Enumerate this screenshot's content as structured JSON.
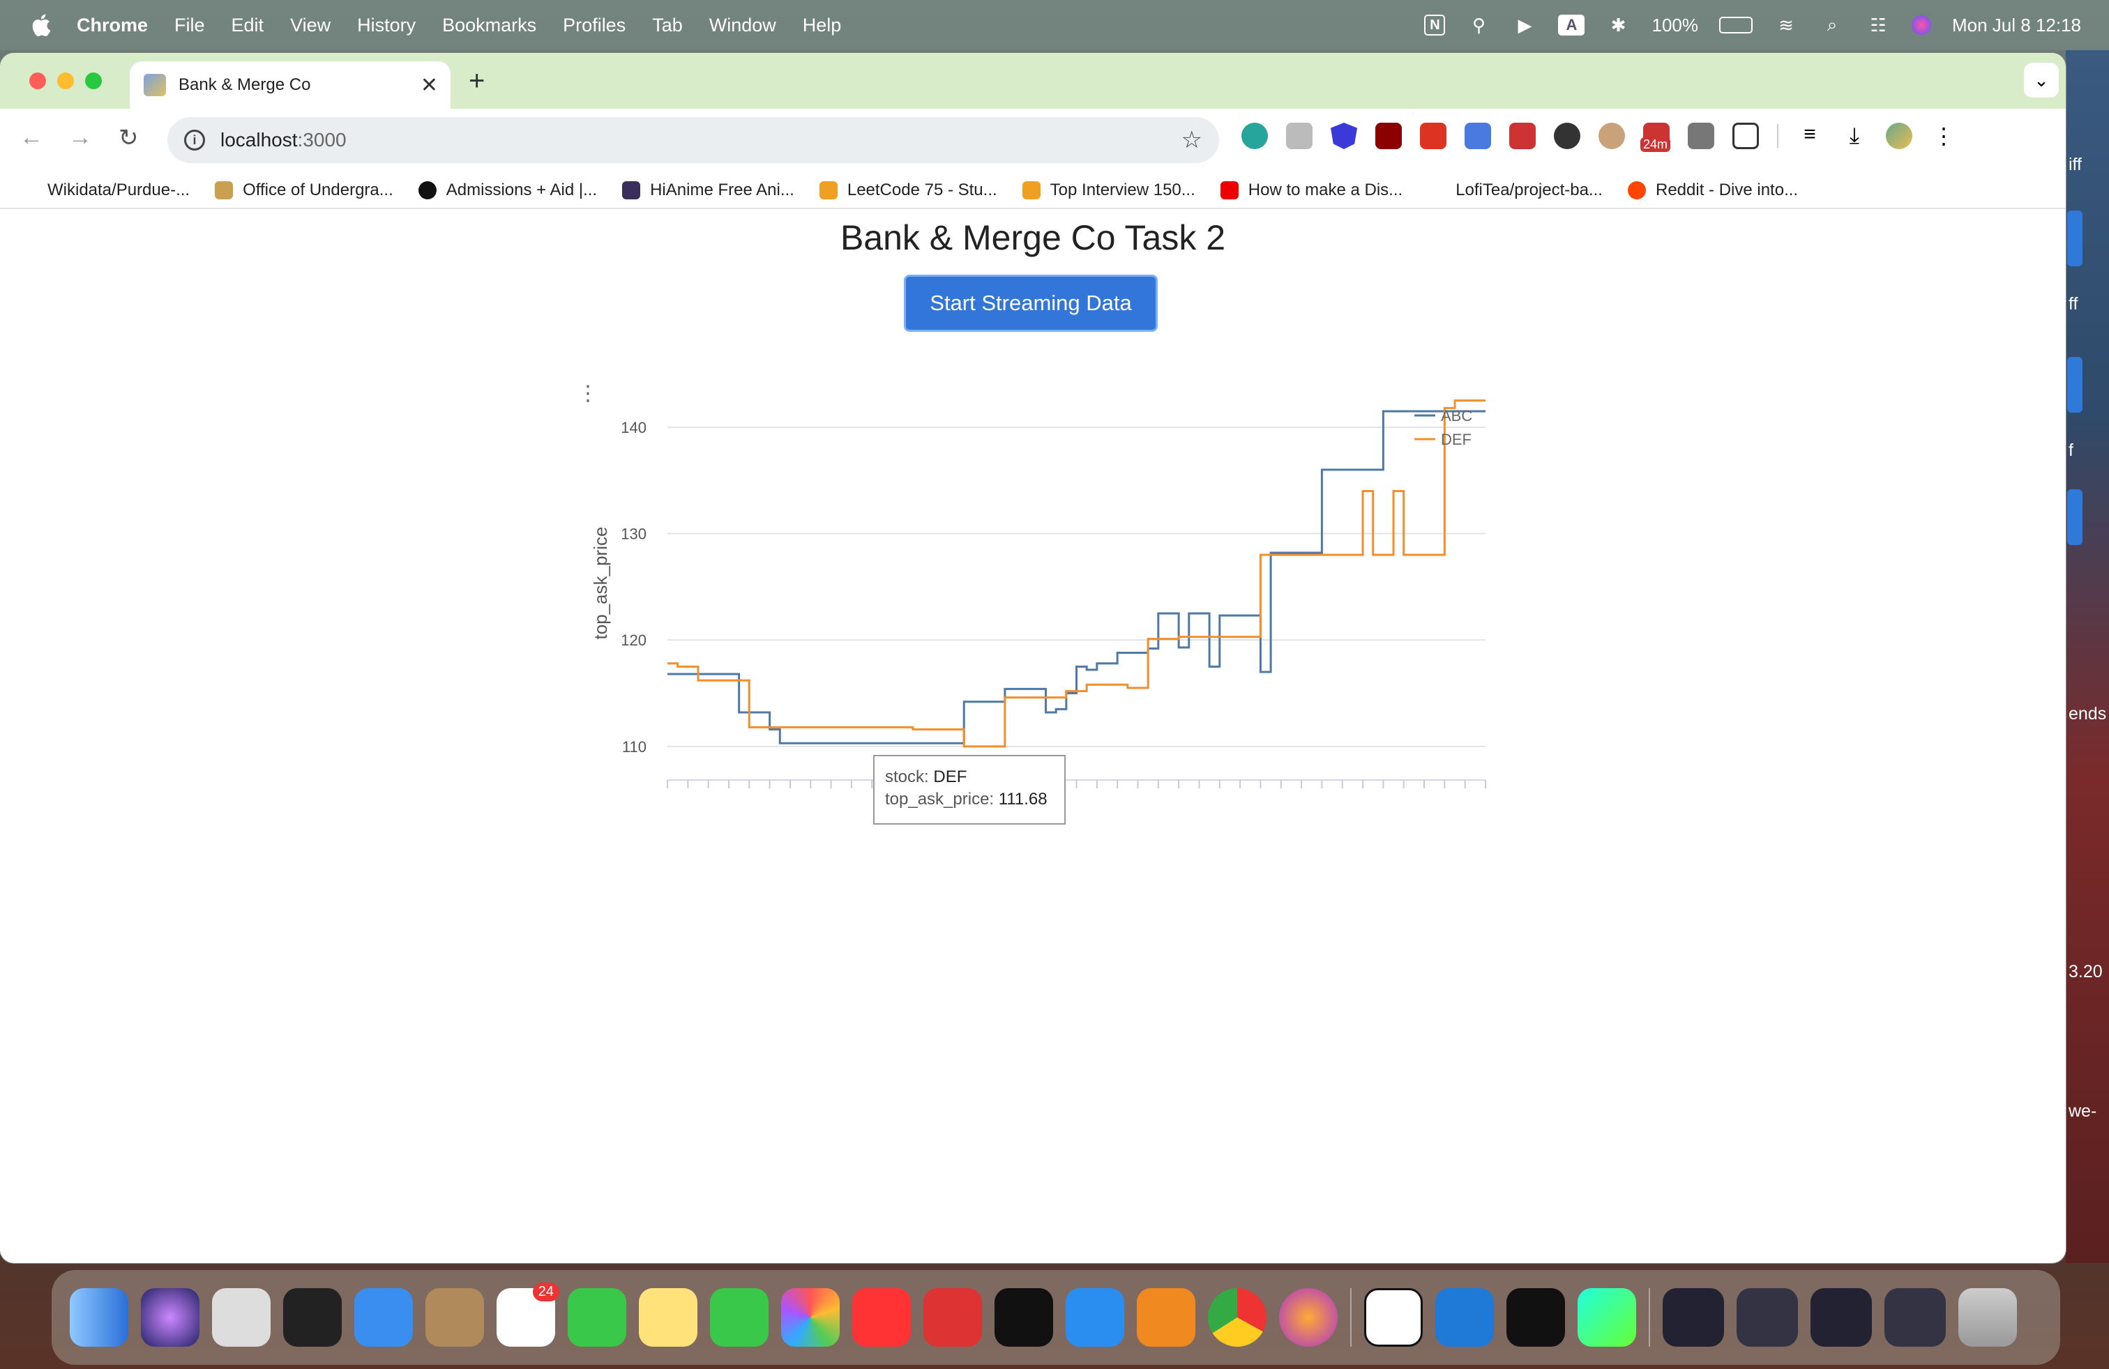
{
  "menubar": {
    "app": "Chrome",
    "items": [
      "File",
      "Edit",
      "View",
      "History",
      "Bookmarks",
      "Profiles",
      "Tab",
      "Window",
      "Help"
    ],
    "battery": "100%",
    "datetime": "Mon Jul 8  12:18"
  },
  "browser": {
    "tab_title": "Bank & Merge Co",
    "url_host": "localhost",
    "url_port": ":3000",
    "extension_timer_badge": "24m",
    "bookmarks": [
      "Wikidata/Purdue-...",
      "Office of Undergra...",
      "Admissions + Aid |...",
      "HiAnime Free Ani...",
      "LeetCode 75 - Stu...",
      "Top Interview 150...",
      "How to make a Dis...",
      "LofiTea/project-ba...",
      "Reddit - Dive into..."
    ]
  },
  "page": {
    "title": "Bank & Merge Co Task 2",
    "button_label": "Start Streaming Data"
  },
  "tooltip": {
    "stock_label": "stock:",
    "stock_value": "DEF",
    "price_label": "top_ask_price:",
    "price_value": "111.68"
  },
  "right_edge_text": [
    "iff",
    "ff",
    "f",
    "ends",
    "3.20",
    "we-"
  ],
  "dock": {
    "reminders_badge": "24"
  },
  "chart_data": {
    "type": "line",
    "ylabel": "top_ask_price",
    "ylim": [
      107.5,
      143.2
    ],
    "yticks": [
      110,
      120,
      130,
      140
    ],
    "legend_placement": "top-right",
    "grid": true,
    "x": [
      0,
      1,
      2,
      3,
      4,
      5,
      6,
      7,
      8,
      9,
      10,
      11,
      12,
      13,
      14,
      15,
      16,
      17,
      18,
      19,
      20,
      21,
      22,
      23,
      24,
      25,
      26,
      27,
      28,
      29,
      30,
      31,
      32,
      33,
      34,
      35,
      36,
      37,
      38,
      39,
      40,
      41,
      42,
      43,
      44,
      45,
      46,
      47,
      48,
      49,
      50,
      51,
      52,
      53,
      54,
      55,
      56,
      57,
      58,
      59,
      60,
      61,
      62,
      63,
      64,
      65,
      66,
      67,
      68,
      69,
      70,
      71,
      72,
      73,
      74,
      75,
      76,
      77,
      78,
      79,
      80
    ],
    "series": [
      {
        "name": "ABC",
        "color": "#4e79a7",
        "values": [
          116.8,
          116.8,
          116.8,
          116.8,
          116.8,
          116.8,
          116.8,
          113.2,
          113.2,
          113.2,
          111.6,
          110.3,
          110.3,
          110.3,
          110.3,
          110.3,
          110.3,
          110.3,
          110.3,
          110.3,
          110.3,
          110.3,
          110.3,
          110.3,
          110.3,
          110.3,
          110.3,
          110.3,
          110.3,
          114.2,
          114.2,
          114.2,
          114.2,
          115.4,
          115.4,
          115.4,
          115.4,
          113.2,
          113.5,
          115.0,
          117.5,
          117.2,
          117.8,
          117.8,
          118.8,
          118.8,
          118.8,
          119.2,
          122.5,
          122.5,
          119.3,
          122.5,
          122.5,
          117.5,
          122.3,
          122.3,
          122.3,
          122.3,
          117.0,
          128.2,
          128.2,
          128.2,
          128.2,
          128.2,
          136.0,
          136.0,
          136.0,
          136.0,
          136.0,
          136.0,
          141.5,
          141.5,
          141.5,
          141.5,
          141.5,
          141.5,
          141.5,
          141.5,
          141.5,
          141.5,
          141.5
        ]
      },
      {
        "name": "DEF",
        "color": "#f28e2b",
        "values": [
          117.8,
          117.5,
          117.5,
          116.2,
          116.2,
          116.2,
          116.2,
          116.2,
          111.8,
          111.8,
          111.8,
          111.8,
          111.8,
          111.8,
          111.8,
          111.8,
          111.8,
          111.8,
          111.8,
          111.8,
          111.8,
          111.8,
          111.8,
          111.8,
          111.6,
          111.6,
          111.6,
          111.6,
          111.6,
          110.0,
          110.0,
          110.0,
          110.0,
          114.6,
          114.6,
          114.6,
          114.6,
          114.6,
          114.6,
          115.2,
          115.2,
          115.8,
          115.8,
          115.8,
          115.8,
          115.5,
          115.5,
          120.1,
          120.1,
          120.1,
          120.3,
          120.3,
          120.3,
          120.3,
          120.3,
          120.3,
          120.3,
          120.3,
          128.0,
          128.0,
          128.0,
          128.0,
          128.0,
          128.0,
          128.0,
          128.0,
          128.0,
          128.0,
          134.0,
          128.0,
          128.0,
          134.0,
          128.0,
          128.0,
          128.0,
          128.0,
          141.8,
          142.5,
          142.5,
          142.5,
          142.5
        ]
      }
    ]
  }
}
